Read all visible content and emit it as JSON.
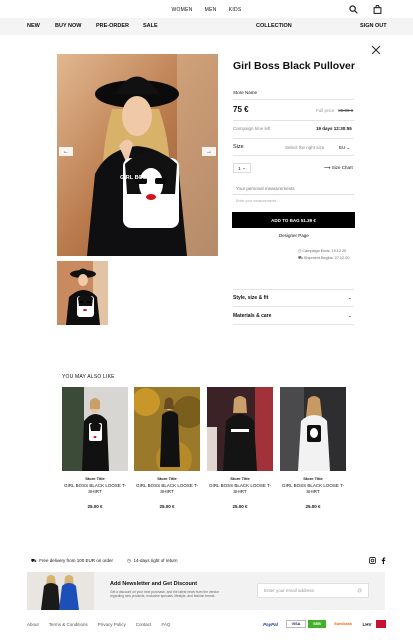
{
  "top_nav": [
    "WOMEN",
    "MEN",
    "KIDS"
  ],
  "main_nav": {
    "new": "NEW",
    "buy_now": "BUY NOW",
    "pre_order": "PRE-ORDER",
    "sale": "SALE",
    "collection": "COLLECTION",
    "sign_out": "SIGN OUT"
  },
  "product": {
    "title": "Girl Boss Black Pullover",
    "store": "Store Name",
    "price": "75 €",
    "full_price_label": "Full price",
    "full_price": "85.00 €",
    "campaign_label": "Campaign time left",
    "campaign_value": "19 days 12:30:55",
    "size_label": "Size",
    "size_hint": "Select the right size",
    "size_region": "EU",
    "qty": "1",
    "size_chart": "Size Chart",
    "measurements_placeholder": "Your personal measurements",
    "measurements_note": "Enter your measurements",
    "add_to_bag": "ADD TO BAG 51.39 €",
    "designer_page": "Designer Page",
    "campaign_ends": "Campaign Ends: 19.12.20",
    "shipment_begins": "Shipment Begins: 27.12.20",
    "accordion": [
      "Style, size & fit",
      "Materials & care"
    ],
    "graphic_text": "GIRL BOSS"
  },
  "recommendations": {
    "heading": "YOU MAY ALSO LIKE",
    "items": [
      {
        "store": "Store Title",
        "name": "GIRL BOSS BLACK LOOSE T-SHIRT",
        "price": "25.00 €"
      },
      {
        "store": "Store Title",
        "name": "GIRL BOSS BLACK LOOSE T-SHIRT",
        "price": "25.00 €"
      },
      {
        "store": "Store Title",
        "name": "GIRL BOSS BLACK LOOSE T-SHIRT",
        "price": "25.00 €"
      },
      {
        "store": "Store Title",
        "name": "GIRL BOSS BLACK LOOSE T-SHIRT",
        "price": "25.00 €"
      }
    ]
  },
  "footer": {
    "delivery": "Free delivery from 100 EUR on order",
    "returns": "14-days right of return",
    "newsletter_title": "Add Newsletter and Get Discount",
    "newsletter_text": "Get a discount on your next purchase, and the latest news from the vendor regarding new products, exclusive specials, lifestyle, and fashion trends.",
    "email_placeholder": "Enter your email address",
    "links": [
      "About",
      "Terms & Conditions",
      "Privacy Policy",
      "Contact",
      "FAQ"
    ],
    "payments": [
      "PayPal",
      "VISA",
      "SEB",
      "Swedbank",
      "LHV"
    ]
  },
  "colors": {
    "nav_bg": "#f4f4f5",
    "button_bg": "#000000",
    "seb": "#43b02a",
    "swedbank": "#ff5f00",
    "lhv": "#1d1d1b"
  },
  "icons": [
    "search-icon",
    "cart-icon",
    "close-icon",
    "arrow-left-icon",
    "arrow-right-icon",
    "ruler-icon",
    "truck-icon",
    "calendar-icon",
    "instagram-icon",
    "facebook-icon",
    "at-icon",
    "chevron-down-icon"
  ]
}
